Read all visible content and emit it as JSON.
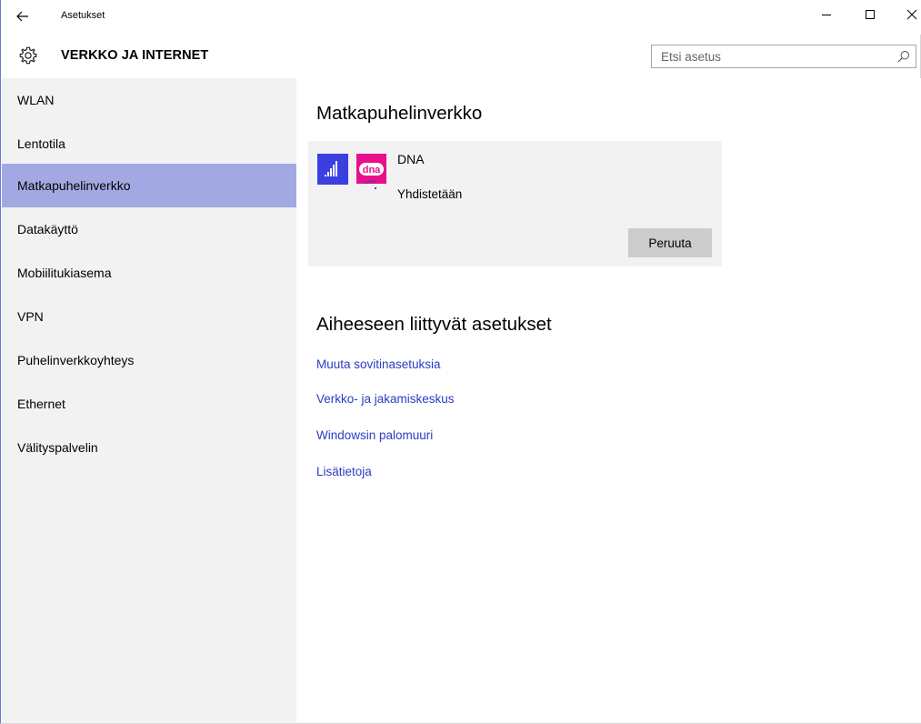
{
  "window": {
    "app_title": "Asetukset",
    "controls": {
      "minimize_icon": "minimize-icon",
      "maximize_icon": "maximize-icon",
      "close_icon": "close-icon"
    }
  },
  "header": {
    "icon": "gear-icon",
    "title": "VERKKO JA INTERNET",
    "search_placeholder": "Etsi asetus"
  },
  "sidebar": {
    "items": [
      {
        "label": "WLAN",
        "active": false
      },
      {
        "label": "Lentotila",
        "active": false
      },
      {
        "label": "Matkapuhelinverkko",
        "active": true
      },
      {
        "label": "Datakäyttö",
        "active": false
      },
      {
        "label": "Mobiilitukiasema",
        "active": false
      },
      {
        "label": "VPN",
        "active": false
      },
      {
        "label": "Puhelinverkkoyhteys",
        "active": false
      },
      {
        "label": "Ethernet",
        "active": false
      },
      {
        "label": "Välityspalvelin",
        "active": false
      }
    ]
  },
  "main": {
    "title": "Matkapuhelinverkko",
    "network": {
      "operator_logo_text": "dna",
      "operator_name": "DNA",
      "status": "Yhdistetään",
      "cancel_label": "Peruuta"
    },
    "related": {
      "title": "Aiheeseen liittyvät asetukset",
      "links": [
        "Muuta sovitinasetuksia",
        "Verkko- ja jakamiskeskus",
        "Windowsin palomuuri",
        "Lisätietoja"
      ]
    }
  },
  "colors": {
    "accent_active": "#a2a9e2",
    "signal_tile": "#3a3fe0",
    "operator_brand": "#e8108a",
    "link": "#2b3cc4",
    "sidebar_bg": "#f2f2f2"
  }
}
